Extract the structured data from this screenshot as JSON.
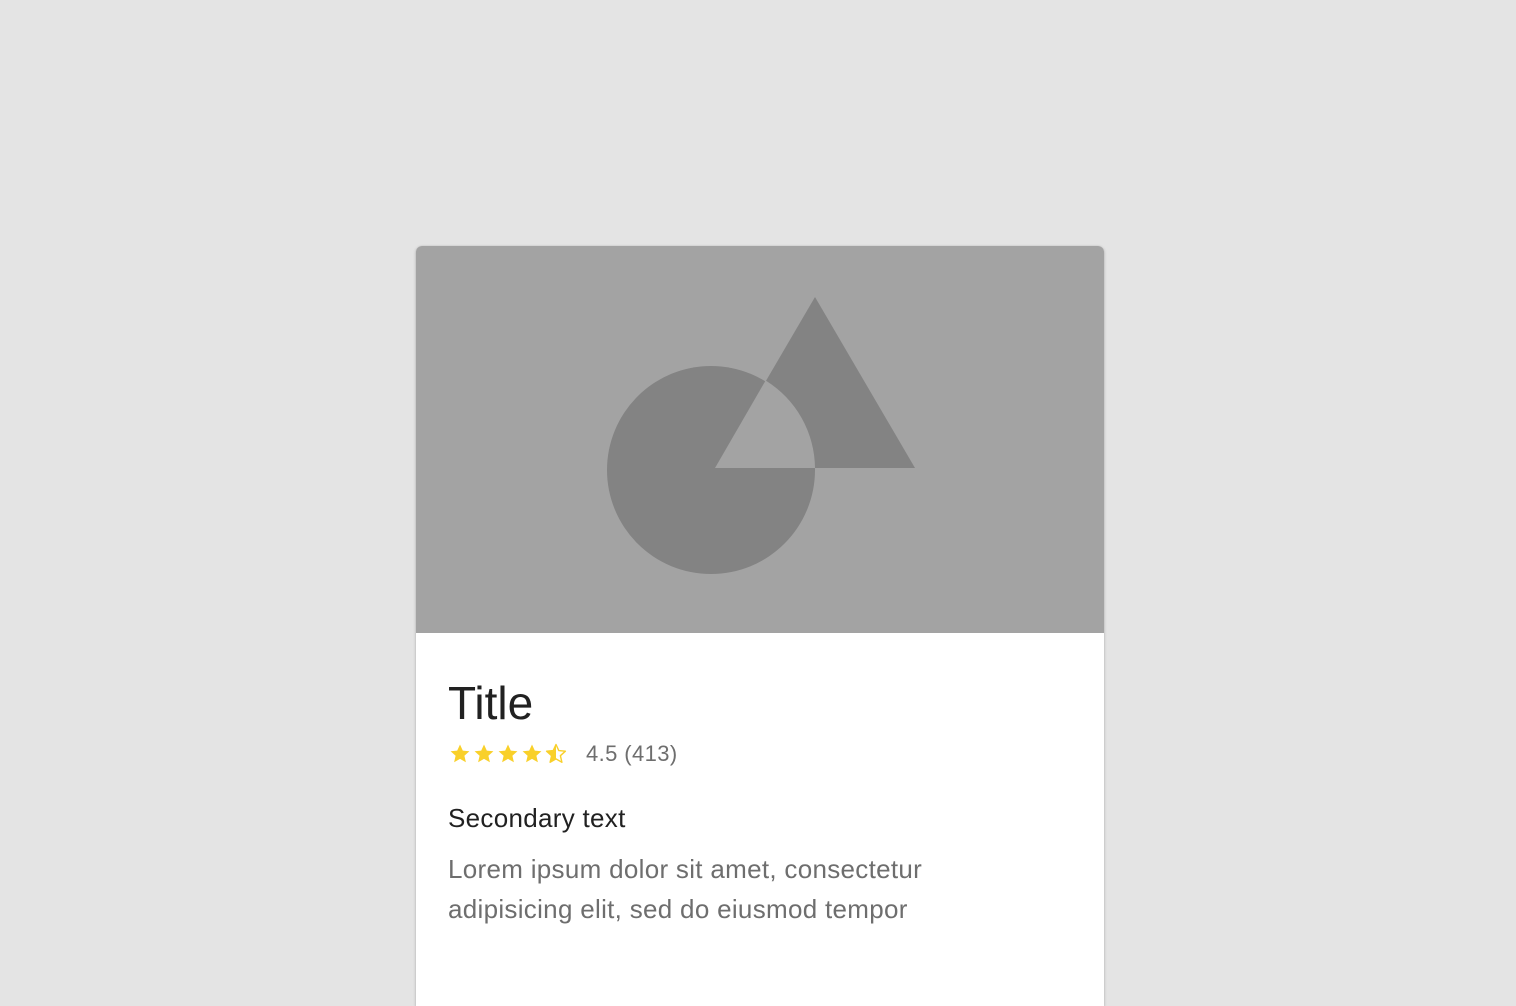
{
  "page": {
    "background_color": "#e4e4e4"
  },
  "card": {
    "media": {
      "description_icon": "image-placeholder-icon",
      "background_color": "#a3a3a3",
      "shape_color": "#838383"
    },
    "title": "Title",
    "rating": {
      "value": 4.5,
      "max": 5,
      "text": "4.5 (413)",
      "star_color": "#f9d02a",
      "icons": [
        "star-icon",
        "star-icon",
        "star-icon",
        "star-icon",
        "star-half-icon"
      ]
    },
    "secondary_text": "Secondary text",
    "body_lines": [
      "Lorem ipsum dolor sit amet, consectetur",
      "adipisicing elit, sed do eiusmod tempor"
    ]
  }
}
